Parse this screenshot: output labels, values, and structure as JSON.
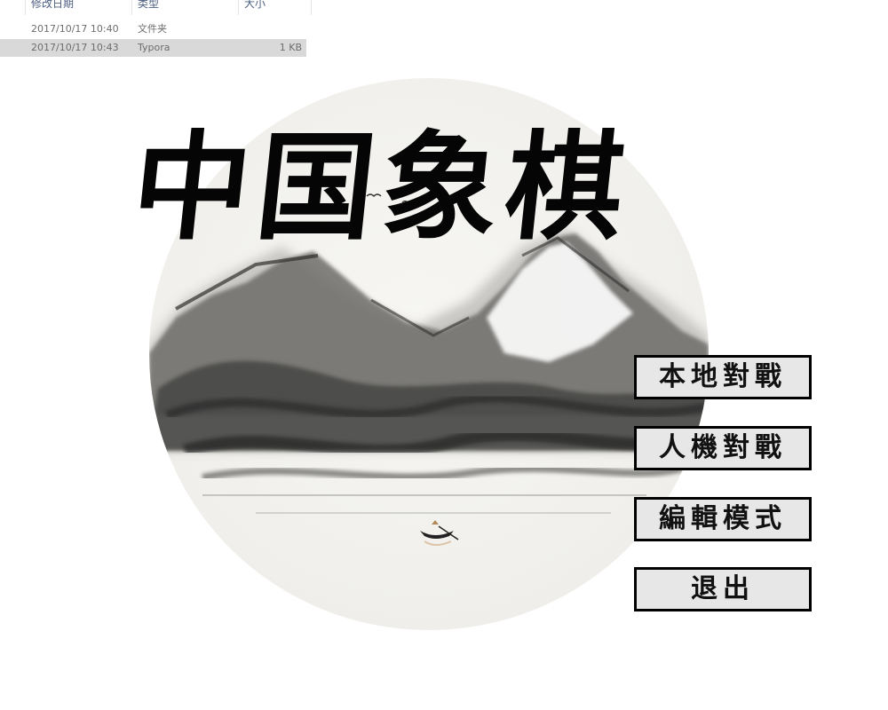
{
  "explorer": {
    "columns": [
      "修改日期",
      "类型",
      "大小"
    ],
    "rows": [
      {
        "date": "2017/10/17 10:40",
        "type": "文件夹",
        "size": ""
      },
      {
        "date": "2017/10/17 10:43",
        "type": "Typora",
        "size": "1 KB",
        "selected": true
      }
    ]
  },
  "game": {
    "title": "中国象棋",
    "menu": [
      "本地對戰",
      "人機對戰",
      "編輯模式",
      "退出"
    ]
  },
  "colors": {
    "background": "#ffffff",
    "button_fill": "#e7e7e7",
    "button_border": "#000000",
    "ink": "#050505",
    "selected_row": "#d9d9d9"
  }
}
